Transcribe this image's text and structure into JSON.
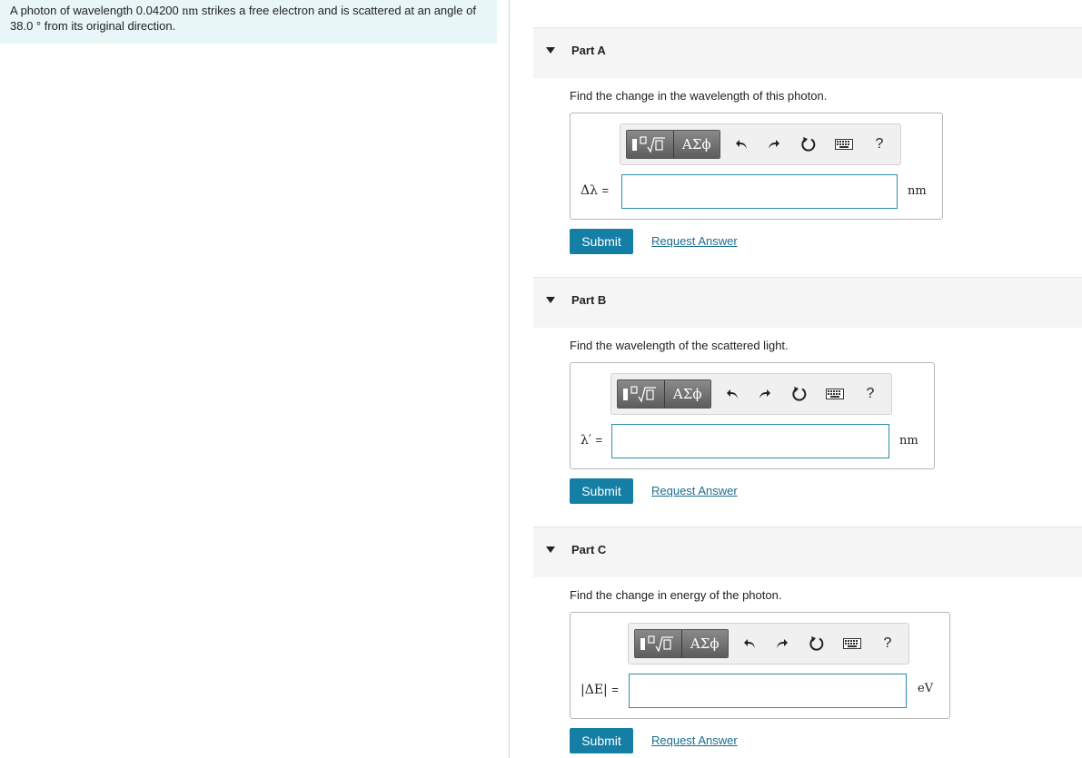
{
  "problem": {
    "text_before": "A photon of wavelength 0.04200 ",
    "unit_symbol": "nm",
    "text_after": " strikes a free electron and is scattered at an angle of",
    "line2": "38.0 ° from its original direction."
  },
  "toolbar": {
    "templates_icon": "fraction-radical-icon",
    "greek_label": "ΑΣϕ",
    "help_label": "?"
  },
  "parts": [
    {
      "title": "Part A",
      "prompt": "Find the change in the wavelength of this photon.",
      "var_label": "Δλ",
      "eq": "=",
      "unit": "nm",
      "submit_label": "Submit",
      "request_label": "Request Answer"
    },
    {
      "title": "Part B",
      "prompt": "Find the wavelength of the scattered light.",
      "var_label": "λ′",
      "eq": "=",
      "unit": "nm",
      "submit_label": "Submit",
      "request_label": "Request Answer"
    },
    {
      "title": "Part C",
      "prompt": "Find the change in energy of the photon.",
      "var_label": "|ΔE|",
      "eq": "=",
      "unit": "eV",
      "submit_label": "Submit",
      "request_label": "Request Answer"
    }
  ]
}
